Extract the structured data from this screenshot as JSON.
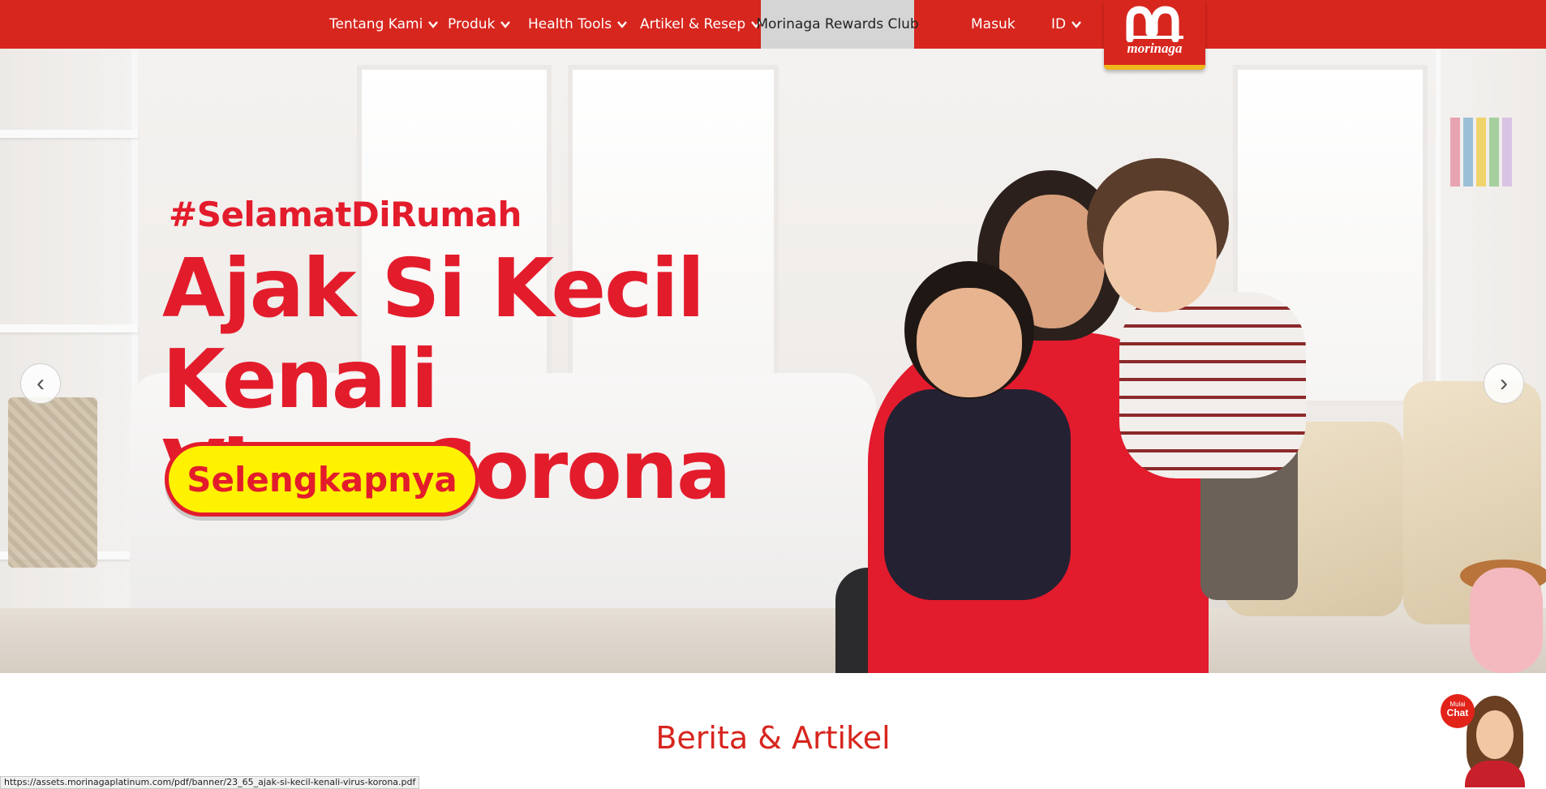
{
  "nav": {
    "items": [
      {
        "label": "Tentang Kami",
        "has_dropdown": true
      },
      {
        "label": "Produk",
        "has_dropdown": true
      },
      {
        "label": "Health Tools",
        "has_dropdown": true
      },
      {
        "label": "Artikel & Resep",
        "has_dropdown": true
      }
    ],
    "rewards_label": "Morinaga Rewards Club",
    "login_label": "Masuk",
    "language_label": "ID",
    "logo_text": "morinaga",
    "colors": {
      "bar": "#d7261e",
      "rewards_bg": "#d5d5d5",
      "logo_accent": "#f1b81c"
    }
  },
  "hero": {
    "hashtag": "#SelamatDiRumah",
    "title_line1": "Ajak Si Kecil Kenali",
    "title_line2": "Virus Corona",
    "cta_label": "Selengkapnya",
    "prev_arrow": "‹",
    "next_arrow": "›",
    "colors": {
      "title": "#e31c2c",
      "cta_bg": "#fff200"
    }
  },
  "section": {
    "title": "Berita & Artikel"
  },
  "chat": {
    "line1": "Mulai",
    "line2": "Chat"
  },
  "status_bar": {
    "url": "https://assets.morinagaplatinum.com/pdf/banner/23_65_ajak-si-kecil-kenali-virus-korona.pdf"
  }
}
